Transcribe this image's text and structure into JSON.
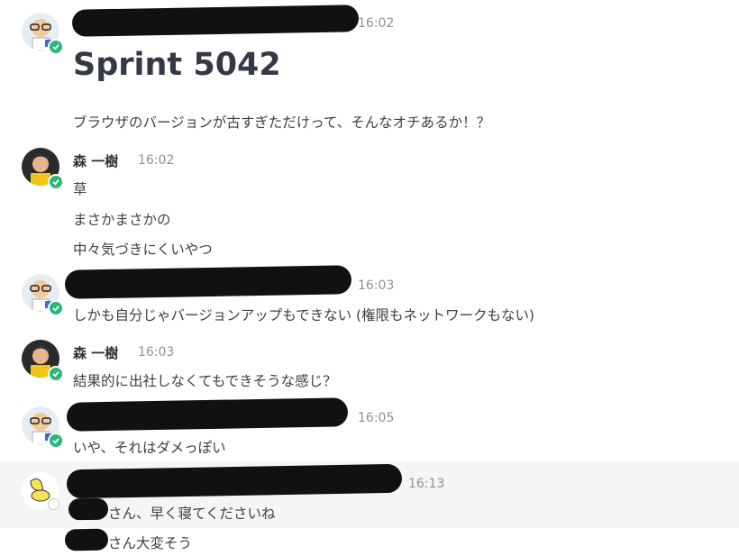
{
  "messages": [
    {
      "time": "16:02",
      "heading": "Sprint 5042",
      "lines": [
        "ブラウザのバージョンが古すぎただけって、そんなオチあるか！？"
      ]
    },
    {
      "name": "森 一樹",
      "time": "16:02",
      "lines": [
        "草",
        "まさかまさかの",
        "中々気づきにくいやつ"
      ]
    },
    {
      "time": "16:03",
      "lines": [
        "しかも自分じゃバージョンアップもできない (権限もネットワークもない)"
      ]
    },
    {
      "name": "森 一樹",
      "time": "16:03",
      "lines": [
        "結果的に出社しなくてもできそうな感じ？"
      ]
    },
    {
      "time": "16:05",
      "lines": [
        "いや、それはダメっぽい"
      ]
    },
    {
      "time": "16:13",
      "lines": [
        "さん、早く寝てくださいね",
        "さん大変そう"
      ]
    }
  ],
  "colors": {
    "online": "#2bb77a",
    "highlight_bg": "#f5f5f5",
    "redaction": "#111111"
  },
  "icons": {
    "status_online": "check-circle-icon",
    "status_offline": "circle-outline-icon"
  }
}
